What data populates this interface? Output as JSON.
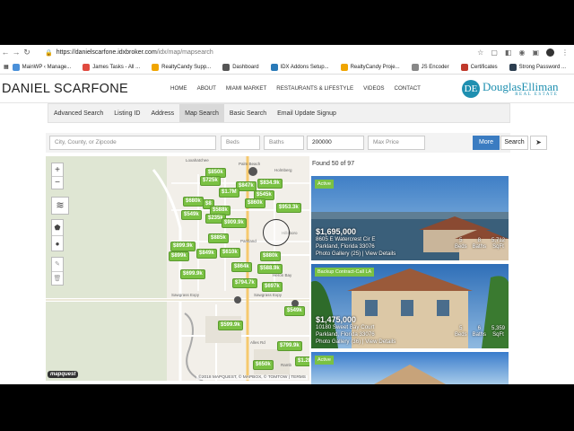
{
  "browser": {
    "url_domain": "https://danielscarfone.idxbroker.com",
    "url_path": "/idx/map/mapsearch",
    "bookmarks": [
      {
        "label": "MainWP ‹ Manage...",
        "color": "#4a90d9"
      },
      {
        "label": "James Tasks - All ...",
        "color": "#e04a3f"
      },
      {
        "label": "RealtyCandy Supp...",
        "color": "#f0a500"
      },
      {
        "label": "Dashboard",
        "color": "#555555"
      },
      {
        "label": "IDX Addons Setup...",
        "color": "#2a7ab8"
      },
      {
        "label": "RealtyCandy Proje...",
        "color": "#f0a500"
      },
      {
        "label": "JS Encoder",
        "color": "#888888"
      },
      {
        "label": "Certificates",
        "color": "#c0392b"
      },
      {
        "label": "Strong Password ...",
        "color": "#2c3e50"
      }
    ]
  },
  "site": {
    "logo": "DANIEL SCARFONE",
    "nav": [
      "HOME",
      "ABOUT",
      "MIAMI MARKET",
      "RESTAURANTS & LIFESTYLE",
      "VIDEOS",
      "CONTACT"
    ],
    "brand": {
      "mark": "DE",
      "name": "DouglasElliman",
      "sub": "REAL ESTATE",
      "color": "#1e8fb0"
    }
  },
  "subtabs": [
    "Advanced Search",
    "Listing ID",
    "Address",
    "Map Search",
    "Basic Search",
    "Email Update Signup"
  ],
  "search": {
    "location_placeholder": "City, County, or Zipcode",
    "beds_placeholder": "Beds",
    "baths_placeholder": "Baths",
    "min_price": "200000",
    "max_price_placeholder": "Max Price",
    "more_label": "More",
    "search_label": "Search"
  },
  "map": {
    "zoom_in": "+",
    "zoom_out": "−",
    "pins": [
      "$850k",
      "$725k",
      "$847k",
      "$834.9k",
      "$1.7M",
      "$8",
      "$545k",
      "$860k",
      "$953.3k",
      "$588k",
      "$549k",
      "$680k",
      "$235k",
      "$909.9k",
      "$899.9k",
      "$885k",
      "$610k",
      "$899k",
      "$849k",
      "$699.9k",
      "$864k",
      "$588.9k",
      "$794.7k",
      "$697k",
      "$549k",
      "$599.9k",
      "$799.9k",
      "$650k",
      "$1.2k",
      "$880k"
    ],
    "attribution": "©2018 MAPQUEST, © MAPBOX, © TOMTOW | TERMS",
    "provider": "mapquest",
    "labels": [
      "Palm Beach",
      "Parkland",
      "Sawgrass Expy",
      "Sawgrass Expy",
      "Holmberg",
      "Hillsboro",
      "Heron Bay",
      "Loxahatchee",
      "Alles Rd",
      "Ramb"
    ]
  },
  "results": {
    "found_text": "Found 50 of 97",
    "listings": [
      {
        "status": "Active",
        "price": "$1,695,000",
        "address": "8605 E Watercrest Cir E",
        "city": "Parkland, Florida 33076",
        "links": "Photo Gallery (25) | View Details",
        "beds": "5",
        "baths": "8",
        "sqft": "5,712"
      },
      {
        "status": "Backup Contract-Call LA",
        "price": "$1,475,000",
        "address": "10180 Sweet Bay Court",
        "city": "Parkland, Florida 33076",
        "links": "Photo Gallery (36) | View Details",
        "beds": "5",
        "baths": "6",
        "sqft": "5,359"
      },
      {
        "status": "Active"
      }
    ],
    "stat_labels": {
      "beds": "Beds",
      "baths": "Baths",
      "sqft": "SqFt"
    }
  }
}
